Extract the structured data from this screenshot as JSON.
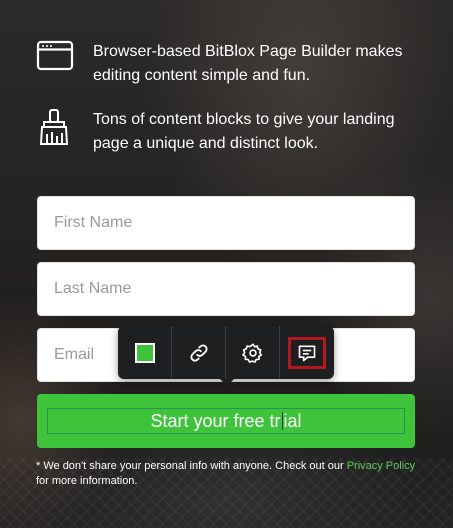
{
  "features": [
    {
      "icon": "browser-window-icon",
      "text": "Browser-based BitBlox Page Builder makes editing content simple and fun."
    },
    {
      "icon": "paintbrush-icon",
      "text": "Tons of content blocks to give your landing page a unique and distinct look."
    }
  ],
  "form": {
    "first_name_placeholder": "First Name",
    "last_name_placeholder": "Last Name",
    "email_placeholder": "Email",
    "cta_before_caret": "Start your free tr",
    "cta_after_caret": "ial"
  },
  "toolbar": {
    "color_value": "#3ec43a",
    "items": [
      "color-swatch",
      "link-icon",
      "gear-icon",
      "comment-icon"
    ],
    "active": "comment-icon"
  },
  "disclaimer": {
    "before": "* We don't share your personal info with anyone. Check out our ",
    "link": "Privacy Policy",
    "after": " for more information."
  },
  "colors": {
    "accent": "#3ec43a",
    "link": "#61c95c",
    "toolbar_bg": "#1d1f21",
    "active_outline": "#b31920"
  }
}
